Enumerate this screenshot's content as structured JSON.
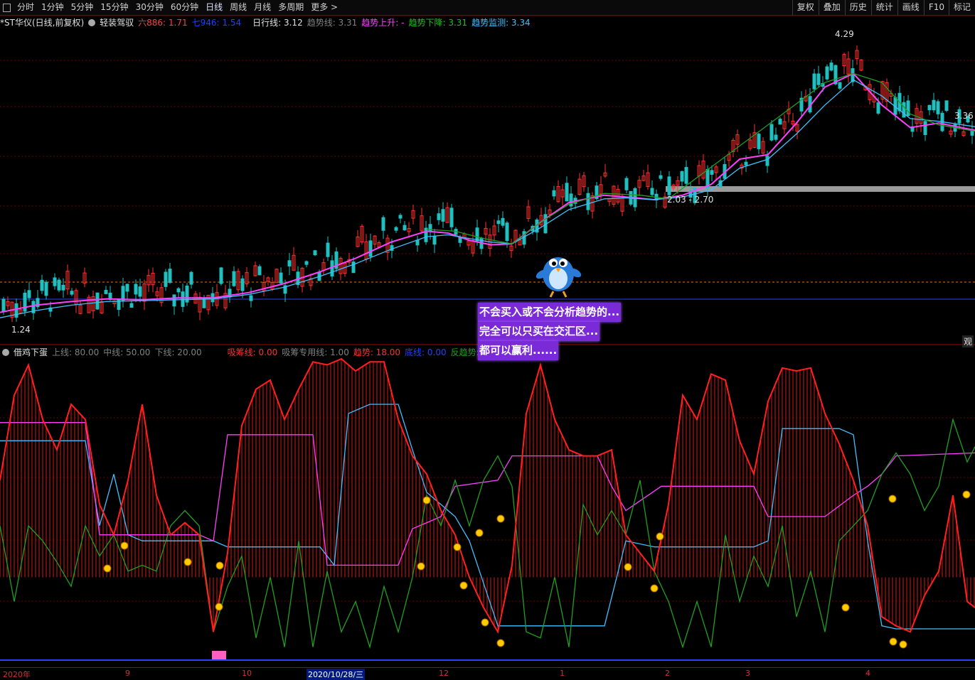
{
  "toolbar": {
    "periods": [
      "分时",
      "1分钟",
      "5分钟",
      "15分钟",
      "30分钟",
      "60分钟",
      "日线",
      "周线",
      "月线",
      "多周期",
      "更多 >"
    ],
    "right_buttons": [
      "复权",
      "叠加",
      "历史",
      "统计",
      "画线",
      "F10",
      "标记"
    ]
  },
  "main_legend": {
    "stock": "*ST华仪(日线,前复权)",
    "indicator": "轻装驾驭",
    "items": [
      {
        "text": "六886: 1.71",
        "color": "#ff4040"
      },
      {
        "text": "七946: 1.54",
        "color": "#2040ff"
      },
      {
        "text": "日行线: 3.12",
        "color": "#e0e0e0"
      },
      {
        "text": "趋势线: 3.31",
        "color": "#808080"
      },
      {
        "text": "趋势上升: -",
        "color": "#ff40ff"
      },
      {
        "text": "趋势下降: 3.31",
        "color": "#20c020"
      },
      {
        "text": "趋势监测: 3.34",
        "color": "#40c0ff"
      }
    ]
  },
  "price_labels": {
    "high": "4.29",
    "right": "3.36",
    "mid": "2.03 - 2.70",
    "low": "1.24"
  },
  "side_tag": "观",
  "sub_legend": {
    "indicator": "借鸡下蛋",
    "items": [
      {
        "text": "上线: 80.00",
        "color": "#808080"
      },
      {
        "text": "中线: 50.00",
        "color": "#808080"
      },
      {
        "text": "下线: 20.00",
        "color": "#808080"
      },
      {
        "text": "吸筹线: 0.00",
        "color": "#ff3030"
      },
      {
        "text": "吸筹专用线: 1.00",
        "color": "#808080"
      },
      {
        "text": "趋势: 18.00",
        "color": "#ff3030"
      },
      {
        "text": "底线: 0.00",
        "color": "#2040ff"
      },
      {
        "text": "反趋势: 65.43",
        "color": "#20a020"
      }
    ]
  },
  "overlay_text": [
    "不会买入或不会分析趋势的...",
    "完全可以只买在交汇区...",
    "都可以赢利......"
  ],
  "dates": [
    "2020年",
    "9",
    "10",
    "2020/10/28/三",
    "12",
    "1",
    "2",
    "3",
    "4"
  ],
  "chart_data": [
    {
      "type": "line",
      "title": "*ST华仪(日线,前复权)",
      "ylim": [
        1.1,
        4.45
      ],
      "series": [
        {
          "name": "日行线",
          "color": "#ff40ff",
          "x": [
            0,
            50,
            100,
            150,
            200,
            250,
            300,
            350,
            400,
            450,
            500,
            550,
            600,
            630,
            660,
            690,
            720,
            760,
            800,
            850,
            880,
            920,
            960,
            1000,
            1040,
            1080,
            1120,
            1160,
            1200,
            1240,
            1280,
            1320,
            1371
          ],
          "values": [
            1.3,
            1.38,
            1.42,
            1.45,
            1.44,
            1.46,
            1.46,
            1.52,
            1.62,
            1.75,
            1.9,
            2.08,
            2.2,
            2.18,
            2.1,
            2.05,
            2.06,
            2.3,
            2.52,
            2.6,
            2.58,
            2.55,
            2.6,
            2.72,
            3.0,
            3.05,
            3.4,
            3.8,
            3.95,
            3.6,
            3.35,
            3.4,
            3.32
          ]
        },
        {
          "name": "趋势监测",
          "color": "#40c0ff",
          "x": [
            0,
            50,
            100,
            150,
            200,
            250,
            300,
            350,
            400,
            450,
            500,
            550,
            600,
            630,
            660,
            690,
            720,
            760,
            800,
            850,
            880,
            920,
            960,
            1000,
            1040,
            1080,
            1120,
            1160,
            1200,
            1240,
            1280,
            1320,
            1371
          ],
          "values": [
            1.24,
            1.32,
            1.38,
            1.42,
            1.43,
            1.44,
            1.45,
            1.5,
            1.58,
            1.7,
            1.84,
            2.0,
            2.14,
            2.16,
            2.12,
            2.08,
            2.06,
            2.24,
            2.44,
            2.56,
            2.57,
            2.55,
            2.58,
            2.66,
            2.9,
            3.0,
            3.28,
            3.6,
            3.88,
            3.7,
            3.45,
            3.42,
            3.36
          ]
        },
        {
          "name": "趋势下降",
          "color": "#20a020",
          "x": [
            600,
            640,
            680,
            720,
            760,
            800,
            850,
            900,
            940,
            1160,
            1200,
            1240,
            1280,
            1320,
            1371
          ],
          "values": [
            2.22,
            2.2,
            2.12,
            2.06,
            2.3,
            2.5,
            2.62,
            2.6,
            2.56,
            3.85,
            3.95,
            3.85,
            3.5,
            3.38,
            3.31
          ]
        }
      ]
    },
    {
      "type": "line",
      "title": "借鸡下蛋",
      "ylim": [
        0,
        100
      ],
      "series": [
        {
          "name": "趋势",
          "color": "#ff2020",
          "x": [
            0,
            20,
            40,
            60,
            80,
            100,
            120,
            140,
            160,
            180,
            200,
            220,
            240,
            260,
            280,
            300,
            320,
            340,
            360,
            380,
            400,
            420,
            440,
            460,
            480,
            500,
            520,
            540,
            560,
            580,
            600,
            620,
            640,
            660,
            680,
            700,
            720,
            740,
            760,
            780,
            800,
            820,
            840,
            860,
            880,
            900,
            920,
            940,
            960,
            980,
            1000,
            1020,
            1040,
            1060,
            1080,
            1100,
            1120,
            1140,
            1160,
            1180,
            1200,
            1220,
            1240,
            1260,
            1280,
            1300,
            1320,
            1340,
            1360,
            1371
          ],
          "values": [
            60,
            88,
            98,
            80,
            70,
            85,
            80,
            52,
            42,
            60,
            85,
            55,
            42,
            46,
            42,
            10,
            36,
            78,
            90,
            93,
            80,
            90,
            99,
            98,
            100,
            96,
            99,
            99,
            80,
            68,
            62,
            50,
            42,
            28,
            18,
            10,
            32,
            82,
            98,
            80,
            70,
            68,
            68,
            70,
            42,
            36,
            30,
            52,
            88,
            80,
            95,
            93,
            73,
            62,
            86,
            97,
            96,
            97,
            82,
            72,
            60,
            45,
            15,
            12,
            10,
            22,
            30,
            55,
            20,
            18
          ]
        },
        {
          "name": "趋势监测",
          "color": "#40c0ff",
          "x": [
            0,
            120,
            140,
            160,
            180,
            200,
            300,
            320,
            450,
            470,
            490,
            520,
            560,
            580,
            600,
            640,
            660,
            700,
            800,
            850,
            880,
            920,
            960,
            1060,
            1080,
            1100,
            1180,
            1200,
            1220,
            1240,
            1260,
            1371
          ],
          "values": [
            73,
            73,
            45,
            62,
            42,
            40,
            40,
            38,
            38,
            32,
            82,
            85,
            85,
            70,
            56,
            48,
            40,
            12,
            12,
            12,
            40,
            38,
            38,
            38,
            40,
            77,
            77,
            75,
            40,
            12,
            11,
            11
          ]
        },
        {
          "name": "吸筹专用线",
          "color": "#ff40ff",
          "x": [
            0,
            120,
            140,
            200,
            280,
            300,
            320,
            440,
            460,
            560,
            580,
            600,
            620,
            640,
            700,
            720,
            840,
            860,
            880,
            930,
            960,
            1060,
            1080,
            1160,
            1200,
            1220,
            1240,
            1260,
            1371
          ],
          "values": [
            79,
            79,
            42,
            42,
            42,
            40,
            75,
            75,
            32,
            32,
            44,
            46,
            48,
            58,
            60,
            68,
            68,
            58,
            50,
            58,
            58,
            58,
            48,
            48,
            55,
            58,
            62,
            68,
            69
          ]
        },
        {
          "name": "反趋势",
          "color": "#20a020",
          "x": [
            0,
            20,
            40,
            60,
            80,
            100,
            120,
            140,
            160,
            180,
            200,
            220,
            240,
            260,
            280,
            300,
            320,
            340,
            360,
            380,
            400,
            420,
            440,
            460,
            480,
            500,
            520,
            540,
            560,
            580,
            600,
            620,
            640,
            660,
            680,
            700,
            720,
            740,
            760,
            780,
            800,
            820,
            840,
            860,
            880,
            900,
            920,
            940,
            960,
            980,
            1000,
            1020,
            1040,
            1060,
            1080,
            1100,
            1120,
            1140,
            1160,
            1180,
            1200,
            1220,
            1240,
            1260,
            1280,
            1300,
            1320,
            1340,
            1360,
            1371
          ],
          "values": [
            45,
            20,
            45,
            40,
            33,
            25,
            45,
            35,
            42,
            30,
            32,
            30,
            45,
            50,
            45,
            10,
            25,
            35,
            8,
            28,
            5,
            40,
            5,
            30,
            10,
            20,
            5,
            25,
            10,
            28,
            55,
            45,
            60,
            45,
            60,
            68,
            58,
            10,
            8,
            28,
            5,
            52,
            42,
            50,
            42,
            60,
            30,
            20,
            5,
            20,
            5,
            42,
            20,
            35,
            25,
            45,
            15,
            30,
            10,
            40,
            45,
            50,
            62,
            69,
            62,
            50,
            58,
            80,
            66,
            71
          ]
        }
      ]
    }
  ]
}
